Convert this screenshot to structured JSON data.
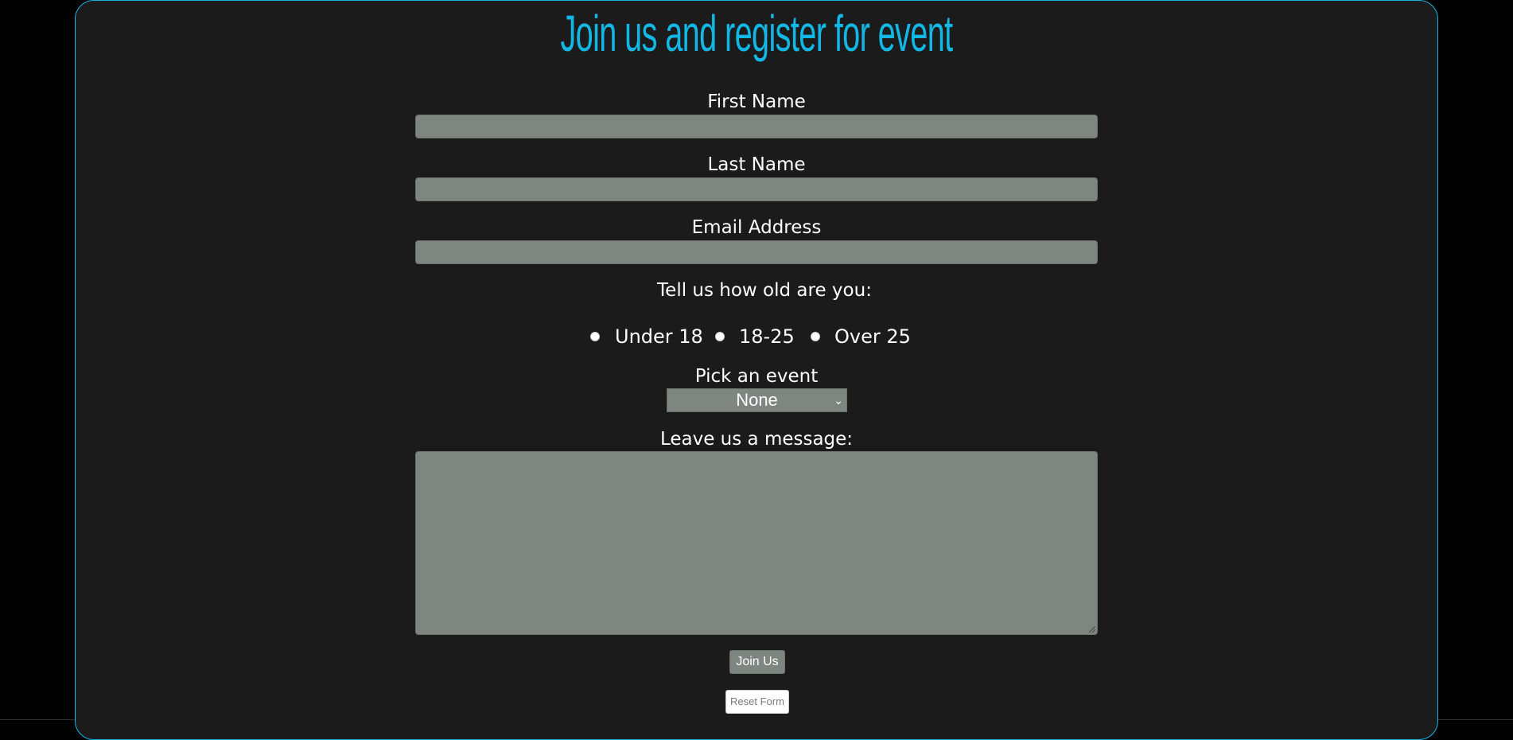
{
  "page": {
    "title": "Join us and register for event",
    "colors": {
      "accent": "#13b7e6",
      "panel": "#1b1b1b",
      "field": "#7f8680",
      "text": "#ffffff"
    }
  },
  "form": {
    "first_name_label": "First Name",
    "last_name_label": "Last Name",
    "email_label": "Email Address",
    "age_prompt": "Tell us how old are you:",
    "age_options": [
      "Under 18",
      "18-25",
      "Over 25"
    ],
    "event_label": "Pick an event",
    "event_selected": "None",
    "message_label": "Leave us a message:",
    "submit_label": "Join Us",
    "reset_label": "Reset Form"
  }
}
